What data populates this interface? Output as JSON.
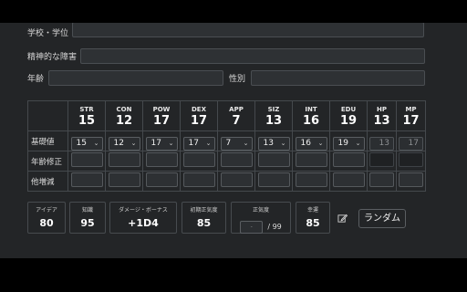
{
  "fields": {
    "school_label": "学校・学位",
    "mental_label": "精神的な障害",
    "age_label": "年齢",
    "gender_label": "性別"
  },
  "stats": {
    "columns": [
      {
        "abbr": "STR",
        "value": "15",
        "base": "15"
      },
      {
        "abbr": "CON",
        "value": "12",
        "base": "12"
      },
      {
        "abbr": "POW",
        "value": "17",
        "base": "17"
      },
      {
        "abbr": "DEX",
        "value": "17",
        "base": "17"
      },
      {
        "abbr": "APP",
        "value": "7",
        "base": "7"
      },
      {
        "abbr": "SIZ",
        "value": "13",
        "base": "13"
      },
      {
        "abbr": "INT",
        "value": "16",
        "base": "16"
      },
      {
        "abbr": "EDU",
        "value": "19",
        "base": "19"
      }
    ],
    "hp": {
      "abbr": "HP",
      "value": "13",
      "base": "13"
    },
    "mp": {
      "abbr": "MP",
      "value": "17",
      "base": "17"
    },
    "row_labels": {
      "base": "基礎値",
      "age_mod": "年齢修正",
      "other_mod": "他増減"
    }
  },
  "derived": {
    "idea": {
      "label": "アイデア",
      "value": "80"
    },
    "knowledge": {
      "label": "知識",
      "value": "95"
    },
    "damage_bonus": {
      "label": "ダメージ・ボーナス",
      "value": "+1D4"
    },
    "initial_san": {
      "label": "初期正気度",
      "value": "85"
    },
    "san": {
      "label": "正気度",
      "placeholder": "-",
      "max": "/ 99"
    },
    "luck": {
      "label": "幸運",
      "value": "85"
    }
  },
  "random_button": "ランダム",
  "icons": {
    "edit": "edit-icon",
    "chevron": "chevron-down-icon"
  },
  "colors": {
    "background": "#232527",
    "border": "#45494d",
    "text": "#e6e6e6"
  }
}
